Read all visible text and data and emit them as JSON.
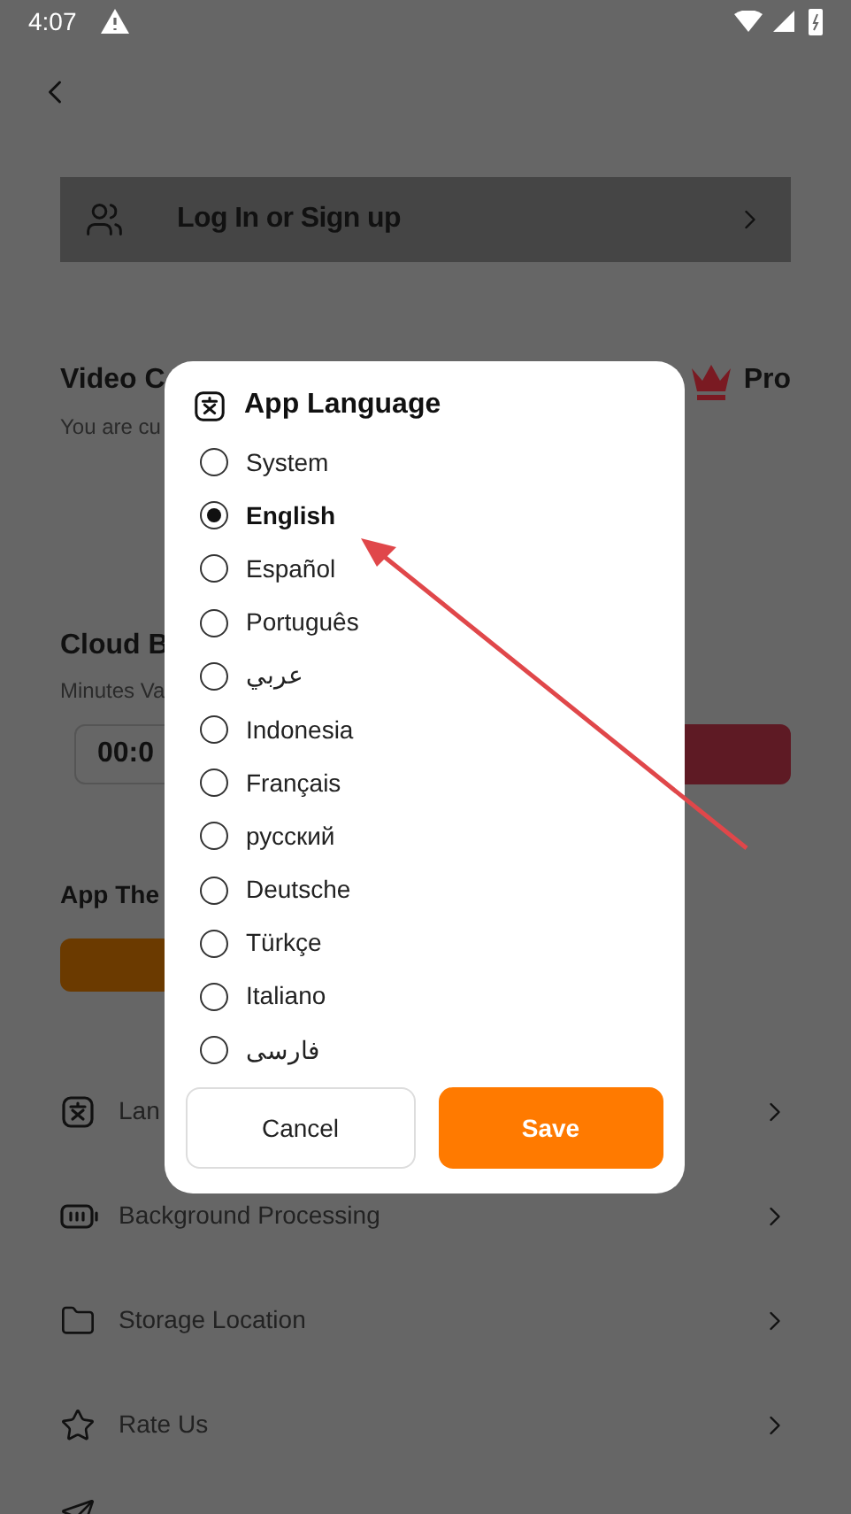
{
  "status_bar": {
    "time": "4:07"
  },
  "login": {
    "label": "Log In or Sign up"
  },
  "video_quality": {
    "title": "Video C",
    "subtitle": "You are cu",
    "badge": "Pro"
  },
  "cloud": {
    "title": "Cloud B",
    "subtitle": "Minutes Va",
    "field_value": "00:0"
  },
  "theme": {
    "title": "App The"
  },
  "settings": [
    {
      "kind": "language",
      "label": "Lan"
    },
    {
      "kind": "battery",
      "label": "Background Processing"
    },
    {
      "kind": "folder",
      "label": "Storage Location"
    },
    {
      "kind": "star",
      "label": "Rate Us"
    },
    {
      "kind": "send"
    }
  ],
  "dialog": {
    "title": "App Language",
    "options": [
      {
        "label": "System",
        "selected": false
      },
      {
        "label": "English",
        "selected": true
      },
      {
        "label": "Español",
        "selected": false
      },
      {
        "label": "Português",
        "selected": false
      },
      {
        "label": "عربي",
        "selected": false
      },
      {
        "label": "Indonesia",
        "selected": false
      },
      {
        "label": "Français",
        "selected": false
      },
      {
        "label": "русский",
        "selected": false
      },
      {
        "label": "Deutsche",
        "selected": false
      },
      {
        "label": "Türkçe",
        "selected": false
      },
      {
        "label": "Italiano",
        "selected": false
      },
      {
        "label": "فارسی",
        "selected": false
      }
    ],
    "buttons": [
      {
        "kind": "secondary",
        "label": "Cancel"
      },
      {
        "kind": "primary",
        "label": "Save"
      }
    ]
  }
}
